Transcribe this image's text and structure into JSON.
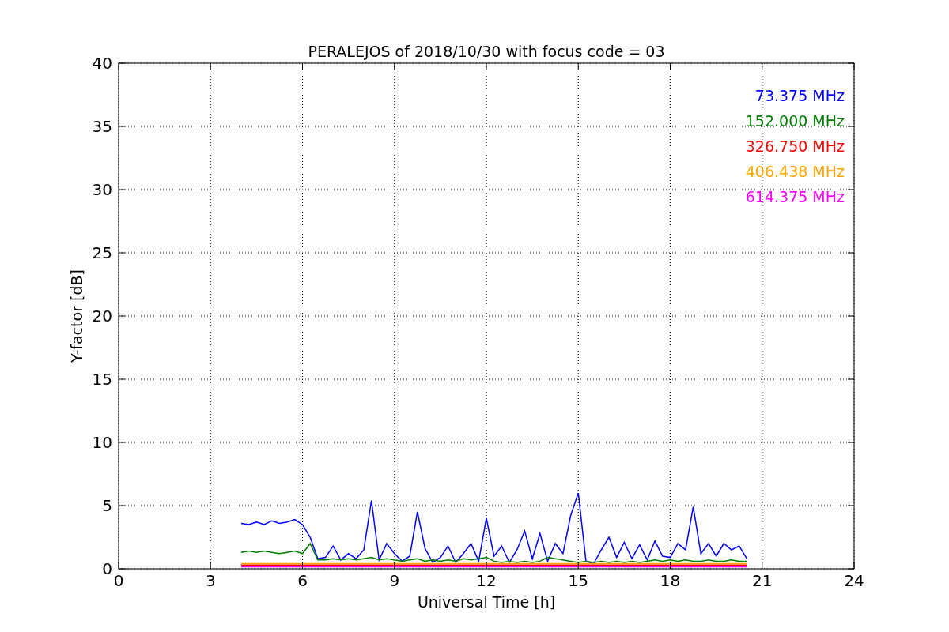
{
  "figure": {
    "chart_data": {
      "type": "line",
      "grid": true,
      "title": "PERALEJOS of 2018/10/30 with focus code = 03",
      "xlabel": "Universal Time [h]",
      "ylabel": "Y-factor [dB]",
      "xlim": [
        0,
        24
      ],
      "ylim": [
        0,
        40
      ],
      "xticks": [
        0,
        3,
        6,
        9,
        12,
        15,
        18,
        21,
        24
      ],
      "yticks": [
        0,
        5,
        10,
        15,
        20,
        25,
        30,
        35,
        40
      ],
      "x": [
        4,
        4.25,
        4.5,
        4.75,
        5,
        5.25,
        5.5,
        5.75,
        6,
        6.25,
        6.5,
        6.75,
        7,
        7.25,
        7.5,
        7.75,
        8,
        8.25,
        8.5,
        8.75,
        9,
        9.25,
        9.5,
        9.75,
        10,
        10.25,
        10.5,
        10.75,
        11,
        11.25,
        11.5,
        11.75,
        12,
        12.25,
        12.5,
        12.75,
        13,
        13.25,
        13.5,
        13.75,
        14,
        14.25,
        14.5,
        14.75,
        15,
        15.25,
        15.5,
        15.75,
        16,
        16.25,
        16.5,
        16.75,
        17,
        17.25,
        17.5,
        17.75,
        18,
        18.25,
        18.5,
        18.75,
        19,
        19.25,
        19.5,
        19.75,
        20,
        20.25,
        20.5
      ],
      "series": [
        {
          "name": "73.375 MHz",
          "color": "#0000ff",
          "values": [
            3.6,
            3.5,
            3.7,
            3.5,
            3.8,
            3.6,
            3.7,
            3.9,
            3.5,
            2.5,
            0.8,
            0.9,
            1.8,
            0.7,
            1.2,
            0.8,
            1.5,
            5.4,
            0.7,
            2.0,
            1.2,
            0.6,
            1.0,
            4.5,
            1.6,
            0.5,
            0.9,
            1.8,
            0.5,
            1.2,
            2.0,
            0.6,
            4.0,
            1.0,
            1.8,
            0.5,
            1.5,
            3.0,
            0.8,
            2.8,
            0.6,
            2.0,
            1.2,
            4.2,
            6.0,
            0.6,
            0.4,
            1.5,
            2.5,
            0.9,
            2.1,
            0.8,
            1.9,
            0.7,
            2.2,
            1.0,
            0.9,
            2.0,
            1.5,
            4.9,
            1.2,
            2.0,
            1.0,
            2.0,
            1.5,
            1.8,
            0.8
          ]
        },
        {
          "name": "152.000 MHz",
          "color": "#008000",
          "values": [
            1.3,
            1.4,
            1.3,
            1.4,
            1.3,
            1.2,
            1.3,
            1.4,
            1.2,
            2.0,
            0.7,
            0.7,
            0.8,
            0.7,
            0.8,
            0.7,
            0.8,
            0.9,
            0.7,
            0.8,
            0.7,
            0.6,
            0.7,
            0.8,
            0.6,
            0.7,
            0.6,
            0.7,
            0.6,
            0.8,
            0.7,
            0.8,
            0.9,
            0.6,
            0.5,
            0.6,
            0.5,
            0.6,
            0.5,
            0.6,
            0.9,
            0.8,
            0.7,
            0.6,
            0.5,
            0.6,
            0.5,
            0.6,
            0.5,
            0.6,
            0.5,
            0.6,
            0.5,
            0.6,
            0.7,
            0.6,
            0.7,
            0.6,
            0.7,
            0.6,
            0.6,
            0.7,
            0.6,
            0.6,
            0.7,
            0.6,
            0.6
          ]
        },
        {
          "name": "326.750 MHz",
          "color": "#ff0000",
          "values": [
            0.3,
            0.3,
            0.3,
            0.3,
            0.3,
            0.3,
            0.3,
            0.3,
            0.3,
            0.3,
            0.3,
            0.3,
            0.3,
            0.3,
            0.3,
            0.3,
            0.3,
            0.3,
            0.3,
            0.3,
            0.3,
            0.3,
            0.3,
            0.3,
            0.3,
            0.3,
            0.3,
            0.3,
            0.3,
            0.3,
            0.3,
            0.3,
            0.3,
            0.3,
            0.3,
            0.3,
            0.3,
            0.3,
            0.3,
            0.3,
            0.3,
            0.3,
            0.3,
            0.3,
            0.3,
            0.3,
            0.3,
            0.3,
            0.3,
            0.3,
            0.3,
            0.3,
            0.3,
            0.3,
            0.3,
            0.3,
            0.3,
            0.3,
            0.3,
            0.3,
            0.3,
            0.3,
            0.3,
            0.3,
            0.3,
            0.3,
            0.3
          ]
        },
        {
          "name": "406.438 MHz",
          "color": "#ffa500",
          "values": [
            0.4,
            0.4,
            0.4,
            0.4,
            0.4,
            0.4,
            0.4,
            0.4,
            0.4,
            0.4,
            0.4,
            0.4,
            0.4,
            0.4,
            0.4,
            0.4,
            0.4,
            0.4,
            0.4,
            0.4,
            0.4,
            0.4,
            0.4,
            0.4,
            0.4,
            0.4,
            0.4,
            0.4,
            0.4,
            0.4,
            0.4,
            0.4,
            0.4,
            0.4,
            0.4,
            0.4,
            0.4,
            0.4,
            0.4,
            0.4,
            0.4,
            0.4,
            0.4,
            0.4,
            0.4,
            0.4,
            0.4,
            0.4,
            0.4,
            0.4,
            0.4,
            0.4,
            0.4,
            0.4,
            0.4,
            0.4,
            0.4,
            0.4,
            0.4,
            0.4,
            0.4,
            0.4,
            0.4,
            0.4,
            0.4,
            0.4,
            0.4
          ]
        },
        {
          "name": "614.375 MHz",
          "color": "#ff00ff",
          "values": [
            0.15,
            0.15,
            0.15,
            0.15,
            0.15,
            0.15,
            0.15,
            0.15,
            0.15,
            0.15,
            0.15,
            0.15,
            0.15,
            0.15,
            0.15,
            0.15,
            0.15,
            0.15,
            0.15,
            0.15,
            0.15,
            0.15,
            0.15,
            0.15,
            0.15,
            0.15,
            0.15,
            0.15,
            0.15,
            0.15,
            0.15,
            0.15,
            0.15,
            0.15,
            0.15,
            0.15,
            0.15,
            0.15,
            0.15,
            0.15,
            0.15,
            0.15,
            0.15,
            0.15,
            0.15,
            0.15,
            0.15,
            0.15,
            0.15,
            0.15,
            0.15,
            0.15,
            0.15,
            0.15,
            0.15,
            0.15,
            0.15,
            0.15,
            0.15,
            0.15,
            0.15,
            0.15,
            0.15,
            0.15,
            0.15,
            0.15,
            0.15
          ]
        }
      ]
    }
  }
}
